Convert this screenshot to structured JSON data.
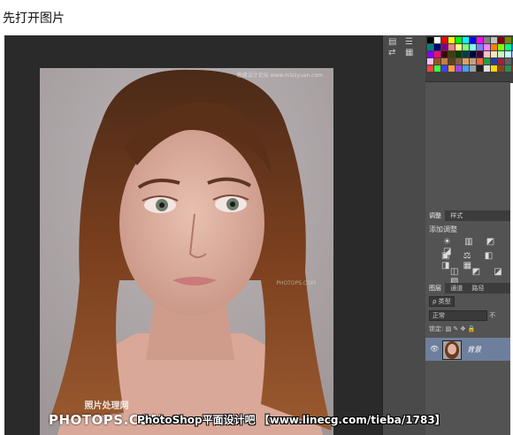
{
  "caption": "先打开图片",
  "image": {
    "watermark_top": "思缘设计论坛 www.missyuan.com",
    "watermark_logo_cn": "照片处理网",
    "watermark_logo_en": "PHOTOPS.COM",
    "watermark_mid": "PHOTOPS.COM"
  },
  "panels": {
    "adjustments_tabs": [
      "调整",
      "样式"
    ],
    "adjustments_title": "添加调整",
    "adj_row1": "☀ ▥ ◩ ◪",
    "adj_row2": "▣ ⚖ ◧ ◨ ▦",
    "adj_row3": "◫ ◩ ◪ ▨",
    "layers_tabs": [
      "图层",
      "通道",
      "路径"
    ],
    "layers_filter": "ρ 类型",
    "blend_mode": "正常",
    "opacity_label": "不",
    "lock_label": "锁定:",
    "layer_name": "背景",
    "swatch_colors": [
      "#000000",
      "#ffffff",
      "#ff0000",
      "#ffff00",
      "#00ff00",
      "#00ffff",
      "#0000ff",
      "#ff00ff",
      "#808080",
      "#c0c0c0",
      "#800000",
      "#808000",
      "#008000",
      "#008080",
      "#000080",
      "#800080",
      "#ff8080",
      "#ffff80",
      "#80ff80",
      "#80ffff",
      "#8080ff",
      "#ff80ff",
      "#ff8000",
      "#80ff00",
      "#00ff80",
      "#0080ff",
      "#8000ff",
      "#ff0080",
      "#400000",
      "#404000",
      "#004000",
      "#004040",
      "#000040",
      "#400040",
      "#ffc0c0",
      "#ffe0c0",
      "#c0ffc0",
      "#c0ffff",
      "#c0c0ff",
      "#ffc0ff",
      "#a05020",
      "#c08040",
      "#604020",
      "#806040",
      "#e0a060",
      "#c0a080",
      "#ff6040",
      "#20a040",
      "#2040a0",
      "#a02040",
      "#606060",
      "#404040",
      "#ff4040",
      "#40ff40",
      "#4040ff",
      "#ffa040",
      "#a040ff",
      "#40a0ff",
      "#a0a0a0",
      "#202020",
      "#e0e0e0",
      "#ffd700",
      "#8b4513",
      "#2e8b57",
      "#b22222"
    ]
  },
  "banner": "PhotoShop平面设计吧 【www.linecg.com/tieba/1783】"
}
